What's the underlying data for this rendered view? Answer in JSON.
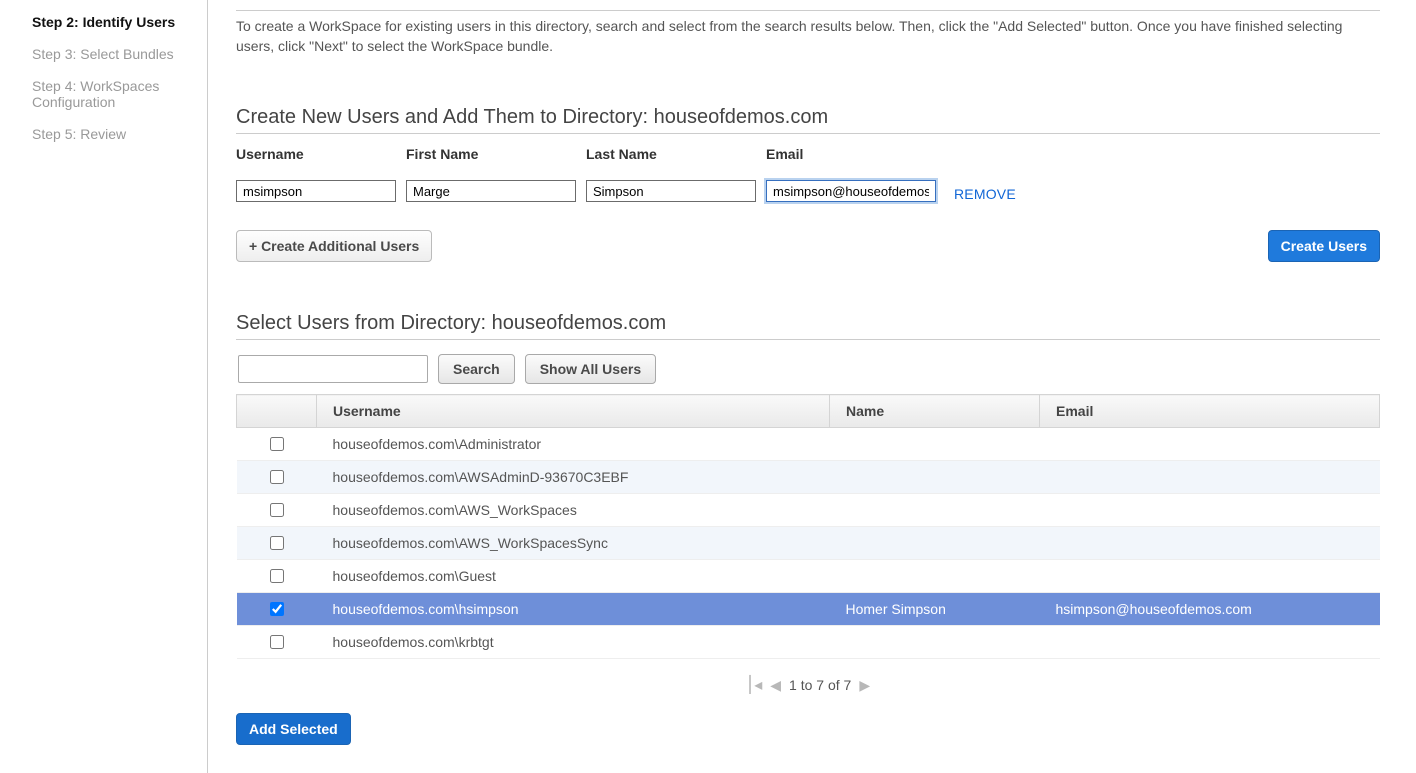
{
  "sidebar": {
    "truncated_top": "",
    "steps": [
      {
        "label": "Step 2: Identify Users",
        "active": true
      },
      {
        "label": "Step 3: Select Bundles",
        "active": false
      },
      {
        "label": "Step 4: WorkSpaces Configuration",
        "active": false
      },
      {
        "label": "Step 5: Review",
        "active": false
      }
    ]
  },
  "header": {
    "title_cut": "Identify Users",
    "intro": "To create a WorkSpace for existing users in this directory, search and select from the search results below. Then, click the \"Add Selected\" button. Once you have finished selecting users, click \"Next\" to select the WorkSpace bundle."
  },
  "create_section": {
    "heading_prefix": "Create New Users and Add Them to Directory: ",
    "directory": "houseofdemos.com",
    "labels": {
      "username": "Username",
      "first": "First Name",
      "last": "Last Name",
      "email": "Email"
    },
    "row": {
      "username": "msimpson",
      "first": "Marge",
      "last": "Simpson",
      "email": "msimpson@houseofdemos.com"
    },
    "remove": "REMOVE",
    "add_more": "+ Create Additional Users",
    "create_btn": "Create Users"
  },
  "select_section": {
    "heading_prefix": "Select Users from Directory: ",
    "directory": "houseofdemos.com",
    "search_btn": "Search",
    "show_all_btn": "Show All Users",
    "columns": {
      "username": "Username",
      "name": "Name",
      "email": "Email"
    },
    "rows": [
      {
        "checked": false,
        "username": "houseofdemos.com\\Administrator",
        "name": "",
        "email": "",
        "selected": false
      },
      {
        "checked": false,
        "username": "houseofdemos.com\\AWSAdminD-93670C3EBF",
        "name": "",
        "email": "",
        "selected": false
      },
      {
        "checked": false,
        "username": "houseofdemos.com\\AWS_WorkSpaces",
        "name": "",
        "email": "",
        "selected": false
      },
      {
        "checked": false,
        "username": "houseofdemos.com\\AWS_WorkSpacesSync",
        "name": "",
        "email": "",
        "selected": false
      },
      {
        "checked": false,
        "username": "houseofdemos.com\\Guest",
        "name": "",
        "email": "",
        "selected": false
      },
      {
        "checked": true,
        "username": "houseofdemos.com\\hsimpson",
        "name": "Homer Simpson",
        "email": "hsimpson@houseofdemos.com",
        "selected": true
      },
      {
        "checked": false,
        "username": "houseofdemos.com\\krbtgt",
        "name": "",
        "email": "",
        "selected": false
      }
    ],
    "pager": "1 to 7 of 7",
    "add_selected": "Add Selected"
  }
}
